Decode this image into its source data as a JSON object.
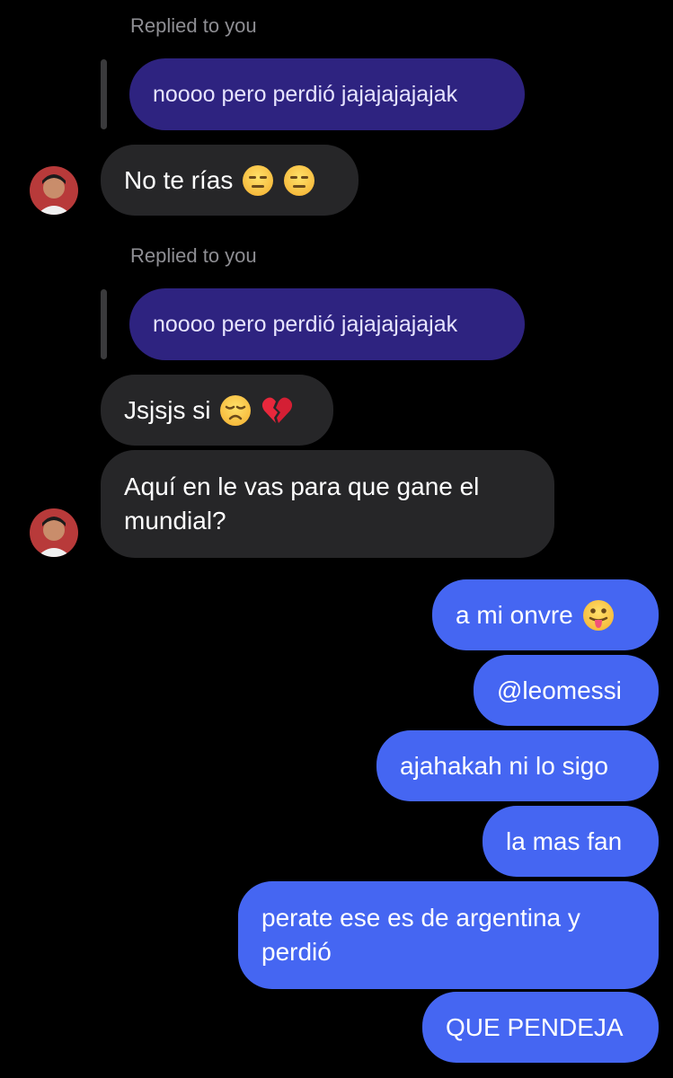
{
  "conversation": {
    "reply_label_1": "Replied to you",
    "quoted_1": "noooo pero perdió jajajajajajak",
    "msg_1": "No te rías",
    "msg_1_emojis": [
      "expressionless-face",
      "expressionless-face"
    ],
    "reply_label_2": "Replied to you",
    "quoted_2": "noooo pero perdió jajajajajajak",
    "msg_2": "Jsjsjs si",
    "msg_2_emojis": [
      "disappointed-face",
      "broken-heart"
    ],
    "msg_3_line1": "Aquí en le vas para que gane el",
    "msg_3_line2": "mundial?",
    "out_1": "a mi onvre",
    "out_1_emojis": [
      "tongue-face"
    ],
    "out_2": "@leomessi",
    "out_3": "ajahakah ni lo sigo",
    "out_4": "la mas fan",
    "out_5_line1": "perate ese es de argentina y",
    "out_5_line2": "perdió",
    "out_6": "QUE PENDEJA"
  },
  "colors": {
    "background": "#000000",
    "incoming_bubble": "#262628",
    "outgoing_bubble": "#4566f2",
    "quoted_bubble": "#2e2380",
    "meta_text": "#8e8e93"
  }
}
